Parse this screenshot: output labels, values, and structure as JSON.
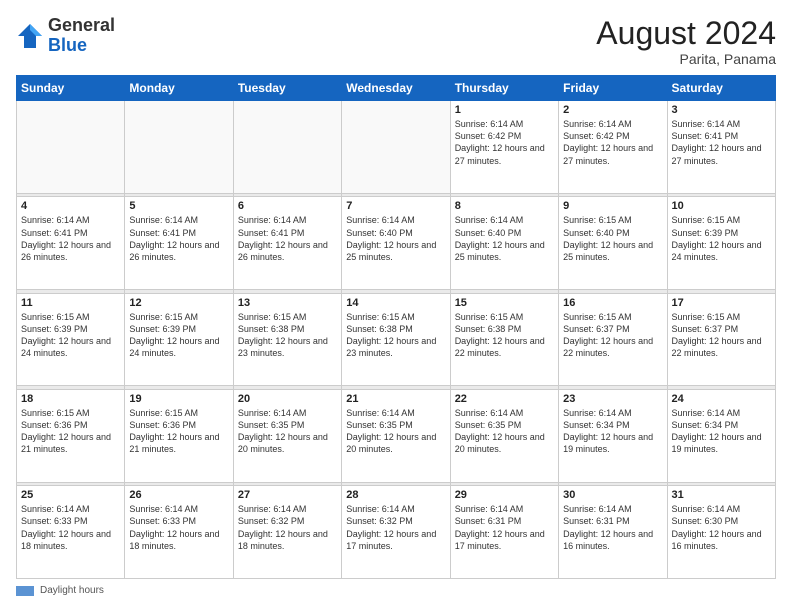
{
  "header": {
    "logo_general": "General",
    "logo_blue": "Blue",
    "month_year": "August 2024",
    "location": "Parita, Panama"
  },
  "calendar": {
    "days_of_week": [
      "Sunday",
      "Monday",
      "Tuesday",
      "Wednesday",
      "Thursday",
      "Friday",
      "Saturday"
    ],
    "weeks": [
      [
        {
          "day": "",
          "info": ""
        },
        {
          "day": "",
          "info": ""
        },
        {
          "day": "",
          "info": ""
        },
        {
          "day": "",
          "info": ""
        },
        {
          "day": "1",
          "info": "Sunrise: 6:14 AM\nSunset: 6:42 PM\nDaylight: 12 hours and 27 minutes."
        },
        {
          "day": "2",
          "info": "Sunrise: 6:14 AM\nSunset: 6:42 PM\nDaylight: 12 hours and 27 minutes."
        },
        {
          "day": "3",
          "info": "Sunrise: 6:14 AM\nSunset: 6:41 PM\nDaylight: 12 hours and 27 minutes."
        }
      ],
      [
        {
          "day": "4",
          "info": "Sunrise: 6:14 AM\nSunset: 6:41 PM\nDaylight: 12 hours and 26 minutes."
        },
        {
          "day": "5",
          "info": "Sunrise: 6:14 AM\nSunset: 6:41 PM\nDaylight: 12 hours and 26 minutes."
        },
        {
          "day": "6",
          "info": "Sunrise: 6:14 AM\nSunset: 6:41 PM\nDaylight: 12 hours and 26 minutes."
        },
        {
          "day": "7",
          "info": "Sunrise: 6:14 AM\nSunset: 6:40 PM\nDaylight: 12 hours and 25 minutes."
        },
        {
          "day": "8",
          "info": "Sunrise: 6:14 AM\nSunset: 6:40 PM\nDaylight: 12 hours and 25 minutes."
        },
        {
          "day": "9",
          "info": "Sunrise: 6:15 AM\nSunset: 6:40 PM\nDaylight: 12 hours and 25 minutes."
        },
        {
          "day": "10",
          "info": "Sunrise: 6:15 AM\nSunset: 6:39 PM\nDaylight: 12 hours and 24 minutes."
        }
      ],
      [
        {
          "day": "11",
          "info": "Sunrise: 6:15 AM\nSunset: 6:39 PM\nDaylight: 12 hours and 24 minutes."
        },
        {
          "day": "12",
          "info": "Sunrise: 6:15 AM\nSunset: 6:39 PM\nDaylight: 12 hours and 24 minutes."
        },
        {
          "day": "13",
          "info": "Sunrise: 6:15 AM\nSunset: 6:38 PM\nDaylight: 12 hours and 23 minutes."
        },
        {
          "day": "14",
          "info": "Sunrise: 6:15 AM\nSunset: 6:38 PM\nDaylight: 12 hours and 23 minutes."
        },
        {
          "day": "15",
          "info": "Sunrise: 6:15 AM\nSunset: 6:38 PM\nDaylight: 12 hours and 22 minutes."
        },
        {
          "day": "16",
          "info": "Sunrise: 6:15 AM\nSunset: 6:37 PM\nDaylight: 12 hours and 22 minutes."
        },
        {
          "day": "17",
          "info": "Sunrise: 6:15 AM\nSunset: 6:37 PM\nDaylight: 12 hours and 22 minutes."
        }
      ],
      [
        {
          "day": "18",
          "info": "Sunrise: 6:15 AM\nSunset: 6:36 PM\nDaylight: 12 hours and 21 minutes."
        },
        {
          "day": "19",
          "info": "Sunrise: 6:15 AM\nSunset: 6:36 PM\nDaylight: 12 hours and 21 minutes."
        },
        {
          "day": "20",
          "info": "Sunrise: 6:14 AM\nSunset: 6:35 PM\nDaylight: 12 hours and 20 minutes."
        },
        {
          "day": "21",
          "info": "Sunrise: 6:14 AM\nSunset: 6:35 PM\nDaylight: 12 hours and 20 minutes."
        },
        {
          "day": "22",
          "info": "Sunrise: 6:14 AM\nSunset: 6:35 PM\nDaylight: 12 hours and 20 minutes."
        },
        {
          "day": "23",
          "info": "Sunrise: 6:14 AM\nSunset: 6:34 PM\nDaylight: 12 hours and 19 minutes."
        },
        {
          "day": "24",
          "info": "Sunrise: 6:14 AM\nSunset: 6:34 PM\nDaylight: 12 hours and 19 minutes."
        }
      ],
      [
        {
          "day": "25",
          "info": "Sunrise: 6:14 AM\nSunset: 6:33 PM\nDaylight: 12 hours and 18 minutes."
        },
        {
          "day": "26",
          "info": "Sunrise: 6:14 AM\nSunset: 6:33 PM\nDaylight: 12 hours and 18 minutes."
        },
        {
          "day": "27",
          "info": "Sunrise: 6:14 AM\nSunset: 6:32 PM\nDaylight: 12 hours and 18 minutes."
        },
        {
          "day": "28",
          "info": "Sunrise: 6:14 AM\nSunset: 6:32 PM\nDaylight: 12 hours and 17 minutes."
        },
        {
          "day": "29",
          "info": "Sunrise: 6:14 AM\nSunset: 6:31 PM\nDaylight: 12 hours and 17 minutes."
        },
        {
          "day": "30",
          "info": "Sunrise: 6:14 AM\nSunset: 6:31 PM\nDaylight: 12 hours and 16 minutes."
        },
        {
          "day": "31",
          "info": "Sunrise: 6:14 AM\nSunset: 6:30 PM\nDaylight: 12 hours and 16 minutes."
        }
      ]
    ]
  },
  "legend": {
    "label": "Daylight hours"
  }
}
